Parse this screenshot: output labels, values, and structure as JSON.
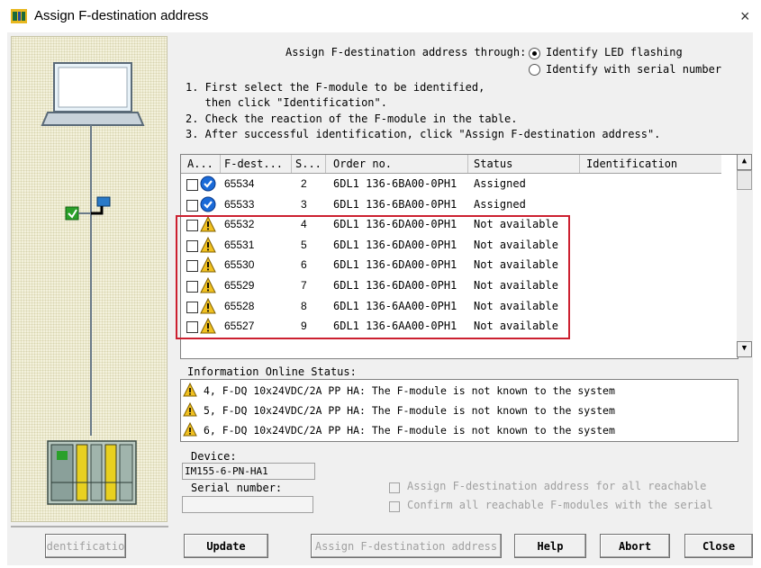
{
  "dialog": {
    "title": "Assign F-destination address",
    "close_glyph": "×"
  },
  "icons": {
    "title": "module-icon",
    "warning": "warning-icon",
    "assigned": "blue-check-icon"
  },
  "assign_through": {
    "label": "Assign F-destination address through:",
    "options": [
      {
        "label": "Identify LED flashing",
        "selected": true
      },
      {
        "label": "Identify with serial number",
        "selected": false
      }
    ]
  },
  "instructions": [
    "1. First select the F-module to be identified,",
    "   then click \"Identification\".",
    "2. Check the reaction of the F-module in the table.",
    "3. After successful identification, click \"Assign F-destination address\"."
  ],
  "table": {
    "columns": [
      "A...",
      "F-dest...",
      "S...",
      "Order no.",
      "Status",
      "Identification"
    ],
    "rows": [
      {
        "icon": "assigned",
        "fdest": "65534",
        "slot": "2",
        "order": "6DL1 136-6BA00-0PH1",
        "status": "Assigned",
        "identification": ""
      },
      {
        "icon": "assigned",
        "fdest": "65533",
        "slot": "3",
        "order": "6DL1 136-6BA00-0PH1",
        "status": "Assigned",
        "identification": ""
      },
      {
        "icon": "warning",
        "fdest": "65532",
        "slot": "4",
        "order": "6DL1 136-6DA00-0PH1",
        "status": "Not available",
        "identification": ""
      },
      {
        "icon": "warning",
        "fdest": "65531",
        "slot": "5",
        "order": "6DL1 136-6DA00-0PH1",
        "status": "Not available",
        "identification": ""
      },
      {
        "icon": "warning",
        "fdest": "65530",
        "slot": "6",
        "order": "6DL1 136-6DA00-0PH1",
        "status": "Not available",
        "identification": ""
      },
      {
        "icon": "warning",
        "fdest": "65529",
        "slot": "7",
        "order": "6DL1 136-6DA00-0PH1",
        "status": "Not available",
        "identification": ""
      },
      {
        "icon": "warning",
        "fdest": "65528",
        "slot": "8",
        "order": "6DL1 136-6AA00-0PH1",
        "status": "Not available",
        "identification": ""
      },
      {
        "icon": "warning",
        "fdest": "65527",
        "slot": "9",
        "order": "6DL1 136-6AA00-0PH1",
        "status": "Not available",
        "identification": ""
      }
    ]
  },
  "info": {
    "label": "Information Online Status:",
    "messages": [
      "4, F-DQ 10x24VDC/2A PP HA: The F-module is not known to the system",
      "5, F-DQ 10x24VDC/2A PP HA: The F-module is not known to the system",
      "6, F-DQ 10x24VDC/2A PP HA: The F-module is not known to the system"
    ]
  },
  "device": {
    "label": "Device:",
    "value": "IM155-6-PN-HA1",
    "serial_label": "Serial number:",
    "serial_value": ""
  },
  "checkboxes": [
    {
      "label": "Assign F-destination address for all reachable",
      "checked": false,
      "enabled": false
    },
    {
      "label": "Confirm all reachable F-modules with the serial",
      "checked": false,
      "enabled": false
    }
  ],
  "buttons": {
    "identification": "dentificatio",
    "update": "Update",
    "assign": "Assign F-destination address",
    "help": "Help",
    "abort": "Abort",
    "close": "Close"
  }
}
